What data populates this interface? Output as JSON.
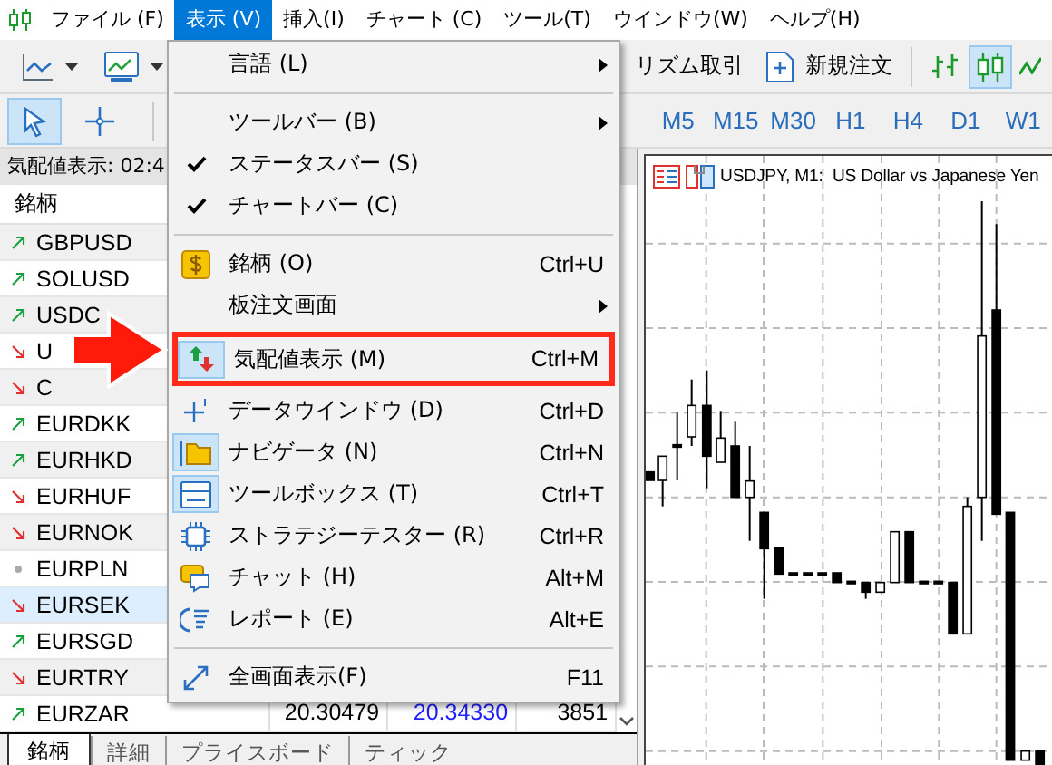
{
  "menu_bar": [
    {
      "label": "ファイル (F)",
      "selected": false
    },
    {
      "label": "表示 (V)",
      "selected": true
    },
    {
      "label": "挿入(I)",
      "selected": false
    },
    {
      "label": "チャート (C)",
      "selected": false
    },
    {
      "label": "ツール(T)",
      "selected": false
    },
    {
      "label": "ウインドウ(W)",
      "selected": false
    },
    {
      "label": "ヘルプ(H)",
      "selected": false
    }
  ],
  "toolbar": {
    "algo_trading_label": "リズム取引",
    "new_order_label": "新規注文",
    "chart_types": [
      {
        "kind": "bars",
        "selected": false
      },
      {
        "kind": "candles",
        "selected": true
      },
      {
        "kind": "line",
        "selected": false
      }
    ]
  },
  "tools": [
    {
      "kind": "cursor",
      "selected": true
    },
    {
      "kind": "crosshair",
      "selected": false
    }
  ],
  "timeframes": [
    {
      "label": "M5",
      "selected": false
    },
    {
      "label": "M15",
      "selected": false
    },
    {
      "label": "M30",
      "selected": false
    },
    {
      "label": "H1",
      "selected": false
    },
    {
      "label": "H4",
      "selected": false
    },
    {
      "label": "D1",
      "selected": false
    },
    {
      "label": "W1",
      "selected": false
    }
  ],
  "market_watch": {
    "title": "気配値表示: 02:4",
    "column_1": "銘柄",
    "rows": [
      {
        "symbol": "GBPUSD",
        "kind": "up",
        "selected": false
      },
      {
        "symbol": "SOLUSD",
        "kind": "up",
        "selected": false
      },
      {
        "symbol": "USDC",
        "kind": "up",
        "selected": false
      },
      {
        "symbol": "U",
        "kind": "down",
        "selected": false
      },
      {
        "symbol": "C",
        "kind": "down",
        "selected": false
      },
      {
        "symbol": "EURDKK",
        "kind": "up",
        "selected": false
      },
      {
        "symbol": "EURHKD",
        "kind": "up",
        "selected": false
      },
      {
        "symbol": "EURHUF",
        "kind": "down",
        "selected": false
      },
      {
        "symbol": "EURNOK",
        "kind": "down",
        "selected": false
      },
      {
        "symbol": "EURPLN",
        "kind": "flat",
        "selected": false
      },
      {
        "symbol": "EURSEK",
        "kind": "down",
        "selected": true
      },
      {
        "symbol": "EURSGD",
        "kind": "up",
        "selected": false
      },
      {
        "symbol": "EURTRY",
        "kind": "down",
        "selected": false
      },
      {
        "symbol": "EURZAR",
        "kind": "up",
        "selected": false,
        "bid": "20.30479",
        "ask": "20.34330",
        "spread": "3851"
      }
    ]
  },
  "bottom_tabs": [
    {
      "label": "銘柄",
      "selected": true
    },
    {
      "label": "詳細",
      "selected": false
    },
    {
      "label": "プライスボード",
      "selected": false
    },
    {
      "label": "ティック",
      "selected": false
    }
  ],
  "chart": {
    "title": "USDJPY, M1:  US Dollar vs Japanese Yen"
  },
  "view_menu": {
    "items": [
      {
        "kind": "item",
        "label": "言語 (L)",
        "submenu": true,
        "checked": false,
        "highlighted": false
      },
      {
        "kind": "separator"
      },
      {
        "kind": "item",
        "label": "ツールバー (B)",
        "submenu": true,
        "checked": false,
        "highlighted": false
      },
      {
        "kind": "item",
        "label": "ステータスバー (S)",
        "submenu": false,
        "checked": true,
        "highlighted": false
      },
      {
        "kind": "item",
        "label": "チャートバー (C)",
        "submenu": false,
        "checked": true,
        "highlighted": false
      },
      {
        "kind": "separator"
      },
      {
        "kind": "item",
        "label": "銘柄 (O)",
        "shortcut": "Ctrl+U",
        "submenu": false,
        "checked": false,
        "highlighted": false
      },
      {
        "kind": "item",
        "label": "板注文画面",
        "submenu": true,
        "checked": false,
        "highlighted": false
      },
      {
        "kind": "item",
        "label": "気配値表示 (M)",
        "shortcut": "Ctrl+M",
        "submenu": false,
        "checked": true,
        "highlighted": true
      },
      {
        "kind": "item",
        "label": "データウインドウ (D)",
        "shortcut": "Ctrl+D",
        "submenu": false,
        "checked": false,
        "highlighted": false
      },
      {
        "kind": "item",
        "label": "ナビゲータ (N)",
        "shortcut": "Ctrl+N",
        "submenu": false,
        "checked": true,
        "highlighted": false
      },
      {
        "kind": "item",
        "label": "ツールボックス (T)",
        "shortcut": "Ctrl+T",
        "submenu": false,
        "checked": true,
        "highlighted": false
      },
      {
        "kind": "item",
        "label": "ストラテジーテスター (R)",
        "shortcut": "Ctrl+R",
        "submenu": false,
        "checked": false,
        "highlighted": false
      },
      {
        "kind": "item",
        "label": "チャット (H)",
        "shortcut": "Alt+M",
        "submenu": false,
        "checked": false,
        "highlighted": false
      },
      {
        "kind": "item",
        "label": "レポート (E)",
        "shortcut": "Alt+E",
        "submenu": false,
        "checked": false,
        "highlighted": false
      },
      {
        "kind": "separator"
      },
      {
        "kind": "item",
        "label": "全画面表示(F)",
        "shortcut": "F11",
        "submenu": false,
        "checked": false,
        "highlighted": false
      }
    ]
  },
  "callout_arrow": true
}
